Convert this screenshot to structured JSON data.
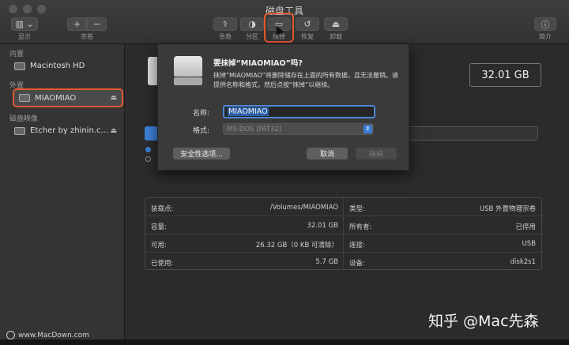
{
  "window": {
    "title": "磁盘工具"
  },
  "toolbar": {
    "view_label": "显示",
    "volume_label": "宗卷",
    "plus": "+",
    "minus": "−",
    "items": [
      {
        "label": "急救",
        "icon": "stethoscope-icon"
      },
      {
        "label": "分区",
        "icon": "partition-icon"
      },
      {
        "label": "抹掉",
        "icon": "erase-icon"
      },
      {
        "label": "恢复",
        "icon": "restore-icon"
      },
      {
        "label": "卸载",
        "icon": "unmount-icon"
      }
    ],
    "info_label": "简介"
  },
  "sidebar": {
    "sections": [
      {
        "title": "内置",
        "items": [
          {
            "label": "Macintosh HD"
          }
        ]
      },
      {
        "title": "外置",
        "items": [
          {
            "label": "MIAOMIAO",
            "selected": true
          }
        ]
      },
      {
        "title": "磁盘映像",
        "items": [
          {
            "label": "Etcher by zhinin.c..."
          }
        ]
      }
    ]
  },
  "main": {
    "capacity": "32.01 GB",
    "info": {
      "rows": [
        {
          "lk": "装载点:",
          "lv": "/Volumes/MIAOMIAO",
          "rk": "类型:",
          "rv": "USB 外置物理宗卷"
        },
        {
          "lk": "容量:",
          "lv": "32.01 GB",
          "rk": "所有者:",
          "rv": "已停用"
        },
        {
          "lk": "可用:",
          "lv": "26.32 GB（0 KB 可清除）",
          "rk": "连接:",
          "rv": "USB"
        },
        {
          "lk": "已使用:",
          "lv": "5.7 GB",
          "rk": "设备:",
          "rv": "disk2s1"
        }
      ]
    }
  },
  "dialog": {
    "title": "要抹掉“MIAOMIAO”吗?",
    "message": "抹掉“MIAOMIAO”将删除储存在上面的所有数据，且无法撤销。请提供名称和格式，然后点按“抹掉”以继续。",
    "name_label": "名称:",
    "name_value": "MIAOMIAO",
    "format_label": "格式:",
    "format_value": "MS-DOS (FAT32)",
    "security_button": "安全性选项...",
    "cancel_button": "取消",
    "erase_button": "抹掉"
  },
  "watermarks": {
    "left": "www.MacDown.com",
    "right": "知乎 @Mac先森"
  }
}
